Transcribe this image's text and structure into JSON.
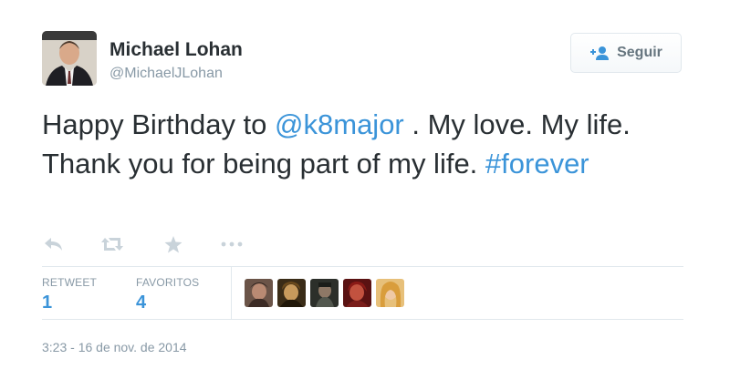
{
  "user": {
    "name": "Michael Lohan",
    "handle": "@MichaelJLohan",
    "avatar_icon": "profile-photo"
  },
  "follow_button": {
    "label": "Seguir",
    "icon": "add-user-icon"
  },
  "tweet": {
    "text_1": "Happy Birthday to ",
    "mention": "@k8major",
    "text_2": " . My love. My life. Thank you for being part of my life. ",
    "hashtag": "#forever"
  },
  "actions": [
    {
      "name": "reply",
      "icon": "reply-icon"
    },
    {
      "name": "retweet",
      "icon": "retweet-icon"
    },
    {
      "name": "favorite",
      "icon": "star-icon"
    },
    {
      "name": "more",
      "icon": "more-icon"
    }
  ],
  "stats": {
    "retweets_label": "RETWEET",
    "retweets_count": "1",
    "favorites_label": "FAVORITOS",
    "favorites_count": "4"
  },
  "favoriters": [
    {
      "icon": "user-avatar-1"
    },
    {
      "icon": "user-avatar-2"
    },
    {
      "icon": "user-avatar-3"
    },
    {
      "icon": "user-avatar-4"
    },
    {
      "icon": "user-avatar-5"
    }
  ],
  "timestamp": "3:23 - 16 de nov. de 2014",
  "colors": {
    "link": "#3b94d9",
    "text": "#292f33",
    "muted": "#8899a6",
    "border": "#e1e8ed"
  }
}
